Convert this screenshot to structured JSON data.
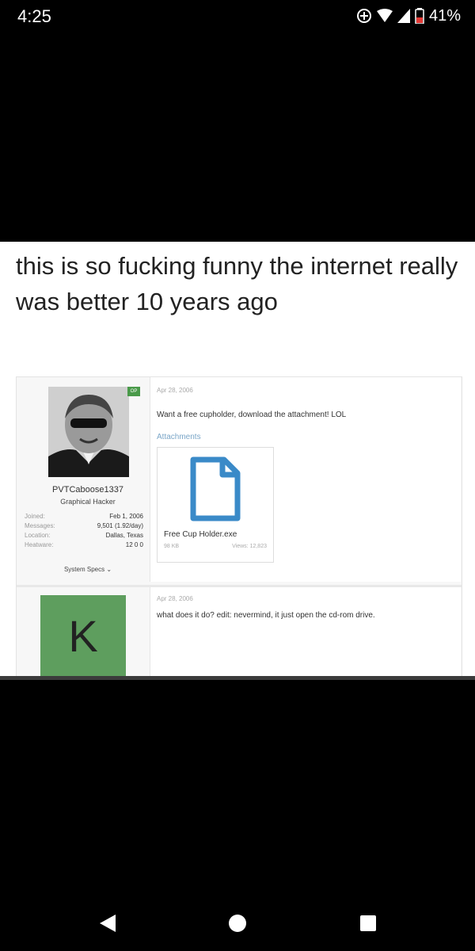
{
  "status_bar": {
    "time": "4:25",
    "battery": "41%"
  },
  "post": {
    "caption": "this is so fucking funny the internet really was better 10 years ago"
  },
  "forum": {
    "user": {
      "op_badge": "OP",
      "username": "PVTCaboose1337",
      "title": "Graphical Hacker",
      "stats": [
        {
          "label": "Joined:",
          "value": "Feb 1, 2006"
        },
        {
          "label": "Messages:",
          "value": "9,501 (1.92/day)"
        },
        {
          "label": "Location:",
          "value": "Dallas, Texas"
        },
        {
          "label": "Heatware:",
          "value": "12 0 0"
        }
      ],
      "specs": "System Specs ⌄"
    },
    "first_post": {
      "date": "Apr 28, 2006",
      "message": "Want a free cupholder, download the attachment! LOL",
      "attachments_label": "Attachments",
      "file_name": "Free Cup Holder.exe",
      "file_size": "98 KB",
      "file_views": "Views: 12,823"
    },
    "second_post": {
      "avatar_letter": "K",
      "date": "Apr 28, 2006",
      "message": "what does it do? edit: nevermind, it just open the cd-rom drive."
    }
  },
  "colors": {
    "accent": "#3a8ac8",
    "avatar_green": "#5e9e5e"
  },
  "nav": {
    "back_icon": "back-triangle-icon",
    "home_icon": "home-circle-icon",
    "recents_icon": "recents-square-icon"
  }
}
